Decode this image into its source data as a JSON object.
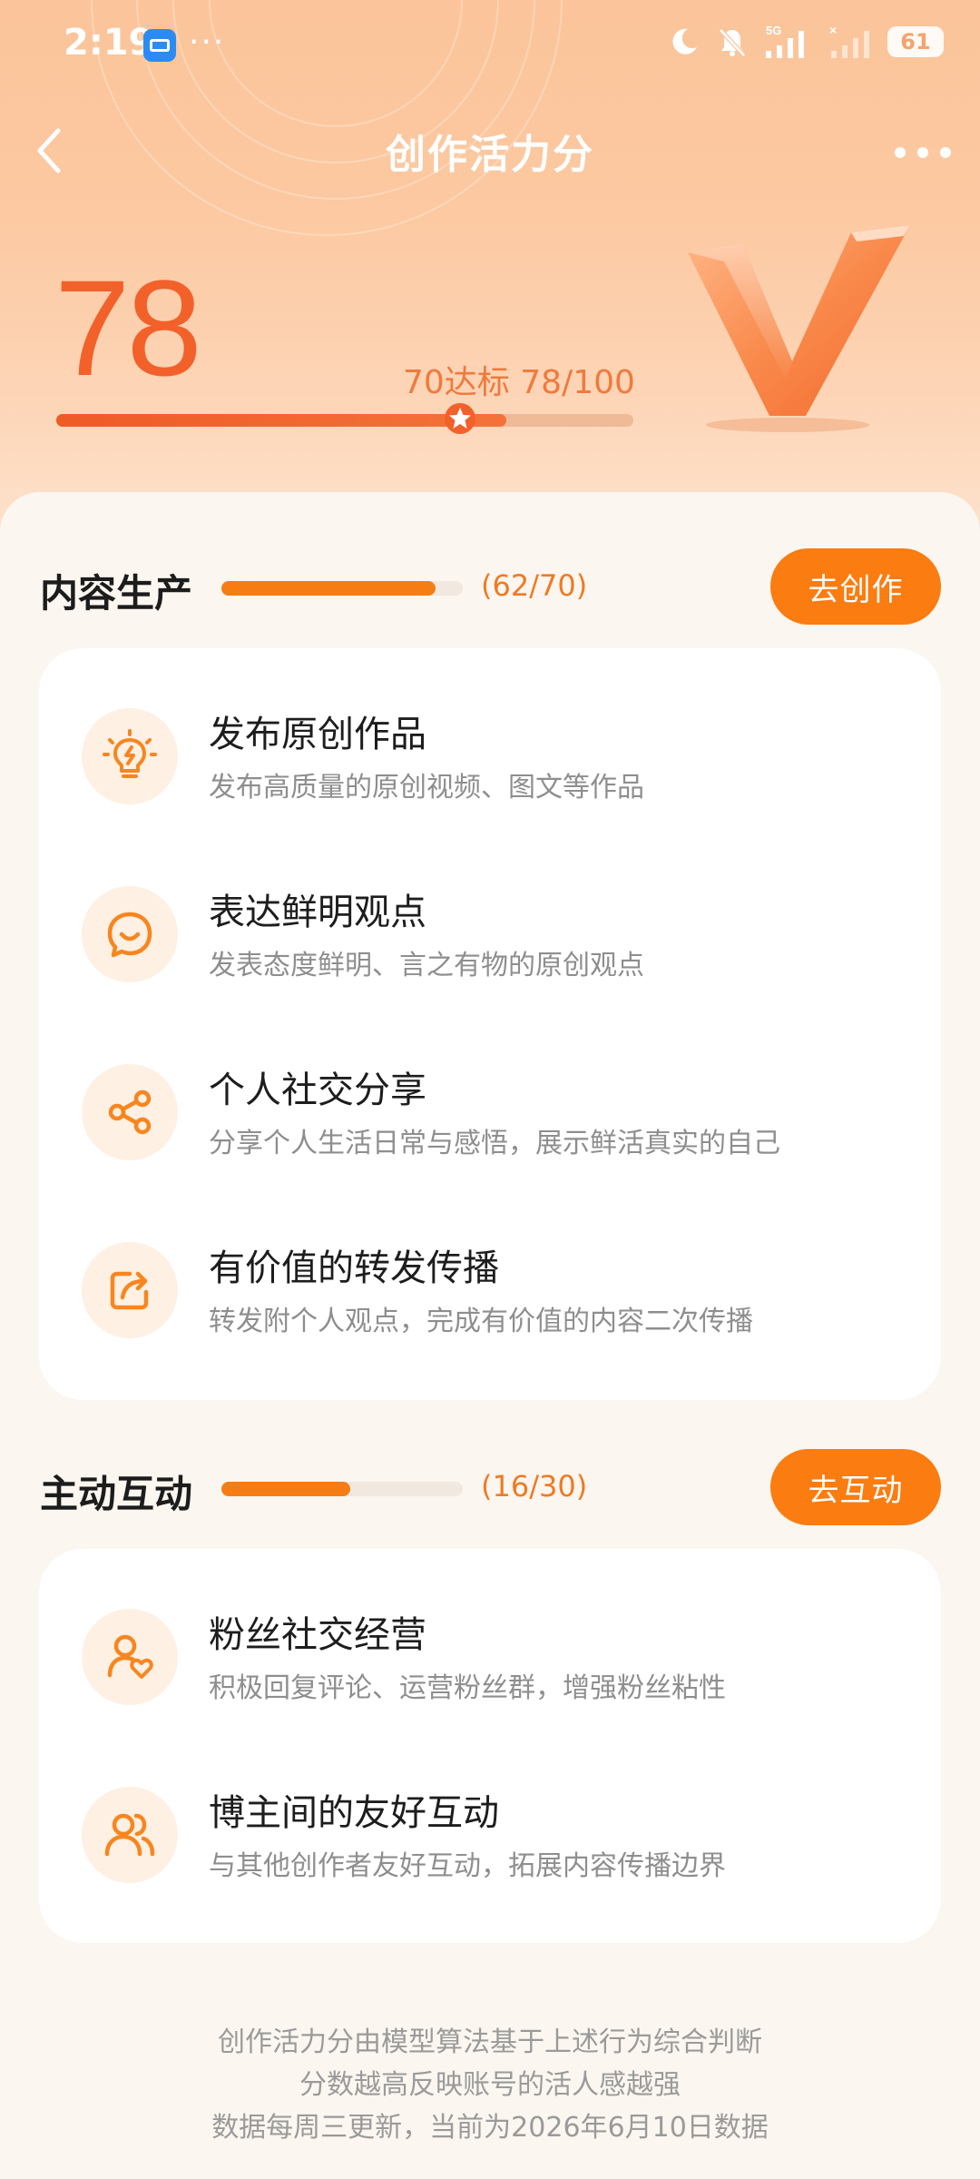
{
  "status_bar": {
    "time": "2:19",
    "more": "···",
    "network": "5G",
    "battery": "61"
  },
  "nav": {
    "title": "创作活力分",
    "back_icon": "chevron-left-icon",
    "more_icon": "more-dots-icon"
  },
  "score": {
    "value": "78",
    "info": "70达标 78/100",
    "progress_fraction": 0.78,
    "threshold_fraction": 0.7
  },
  "sections": [
    {
      "title": "内容生产",
      "progress": "(62/70)",
      "progress_fraction": 0.886,
      "button": "去创作",
      "items": [
        {
          "icon": "lightbulb-icon",
          "title": "发布原创作品",
          "desc": "发布高质量的原创视频、图文等作品"
        },
        {
          "icon": "smile-chat-icon",
          "title": "表达鲜明观点",
          "desc": "发表态度鲜明、言之有物的原创观点"
        },
        {
          "icon": "share-icon",
          "title": "个人社交分享",
          "desc": "分享个人生活日常与感悟，展示鲜活真实的自己"
        },
        {
          "icon": "forward-icon",
          "title": "有价值的转发传播",
          "desc": "转发附个人观点，完成有价值的内容二次传播"
        }
      ]
    },
    {
      "title": "主动互动",
      "progress": "(16/30)",
      "progress_fraction": 0.533,
      "button": "去互动",
      "items": [
        {
          "icon": "user-heart-icon",
          "title": "粉丝社交经营",
          "desc": "积极回复评论、运营粉丝群，增强粉丝粘性"
        },
        {
          "icon": "users-icon",
          "title": "博主间的友好互动",
          "desc": "与其他创作者友好互动，拓展内容传播边界"
        }
      ]
    }
  ],
  "footer": {
    "line1": "创作活力分由模型算法基于上述行为综合判断",
    "line2": "分数越高反映账号的活人感越强",
    "line3": "数据每周三更新，当前为2026年6月10日数据"
  },
  "colors": {
    "accent": "#fb7c10",
    "score": "#f2612a",
    "hero_bg": "#fbc49a"
  }
}
